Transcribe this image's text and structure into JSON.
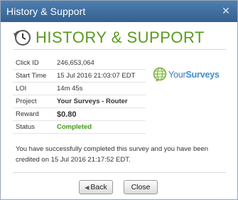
{
  "dialog": {
    "title": "History & Support",
    "close_glyph": "✕",
    "heading": "HISTORY & SUPPORT",
    "heading_icon": "history-clock-icon"
  },
  "details": [
    {
      "key": "Click ID",
      "value": "246,653,064"
    },
    {
      "key": "Start Time",
      "value": "15 Jul 2016 21:03:07 EDT"
    },
    {
      "key": "LOI",
      "value": "14m 45s"
    },
    {
      "key": "Project",
      "value": "Your Surveys - Router"
    },
    {
      "key": "Reward",
      "value": "$0.80"
    },
    {
      "key": "Status",
      "value": "Completed"
    }
  ],
  "logo": {
    "text_part1": "Your",
    "text_part2": "Surveys"
  },
  "message": "You have successfully completed this survey and you have been credited on 15 Jul 2016 21:17:52 EDT.",
  "buttons": {
    "back_label": "Back",
    "close_label": "Close"
  },
  "colors": {
    "titlebar": "#3f6f9f",
    "heading_green": "#5a9a1e",
    "status_green": "#3f9a16",
    "logo_blue": "#3a7bbf"
  }
}
